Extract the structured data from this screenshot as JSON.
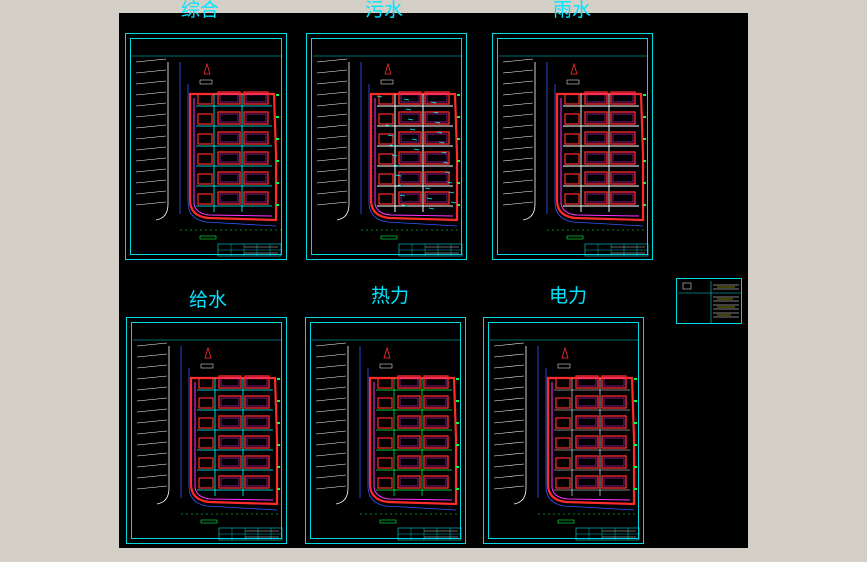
{
  "sheets": [
    {
      "id": "composite",
      "title": "综合",
      "variant": "composite"
    },
    {
      "id": "sewage",
      "title": "污水",
      "variant": "sewage"
    },
    {
      "id": "rain",
      "title": "雨水",
      "variant": "rain"
    },
    {
      "id": "water-supply",
      "title": "给水",
      "variant": "supply"
    },
    {
      "id": "heating",
      "title": "热力",
      "variant": "heat"
    },
    {
      "id": "electric",
      "title": "电力",
      "variant": "power"
    }
  ],
  "colors": {
    "frame": "#00d8e0",
    "title": "#00e5ff",
    "building": "#ff2a2a",
    "pipe_magenta": "#ff33ff",
    "road": "#ffffff",
    "sewage_pipe": "#ffffff",
    "rain_pipe": "#ffffff",
    "supply_pipe": "#00ffff",
    "green": "#00ff44",
    "blue_line": "#3355ff"
  }
}
